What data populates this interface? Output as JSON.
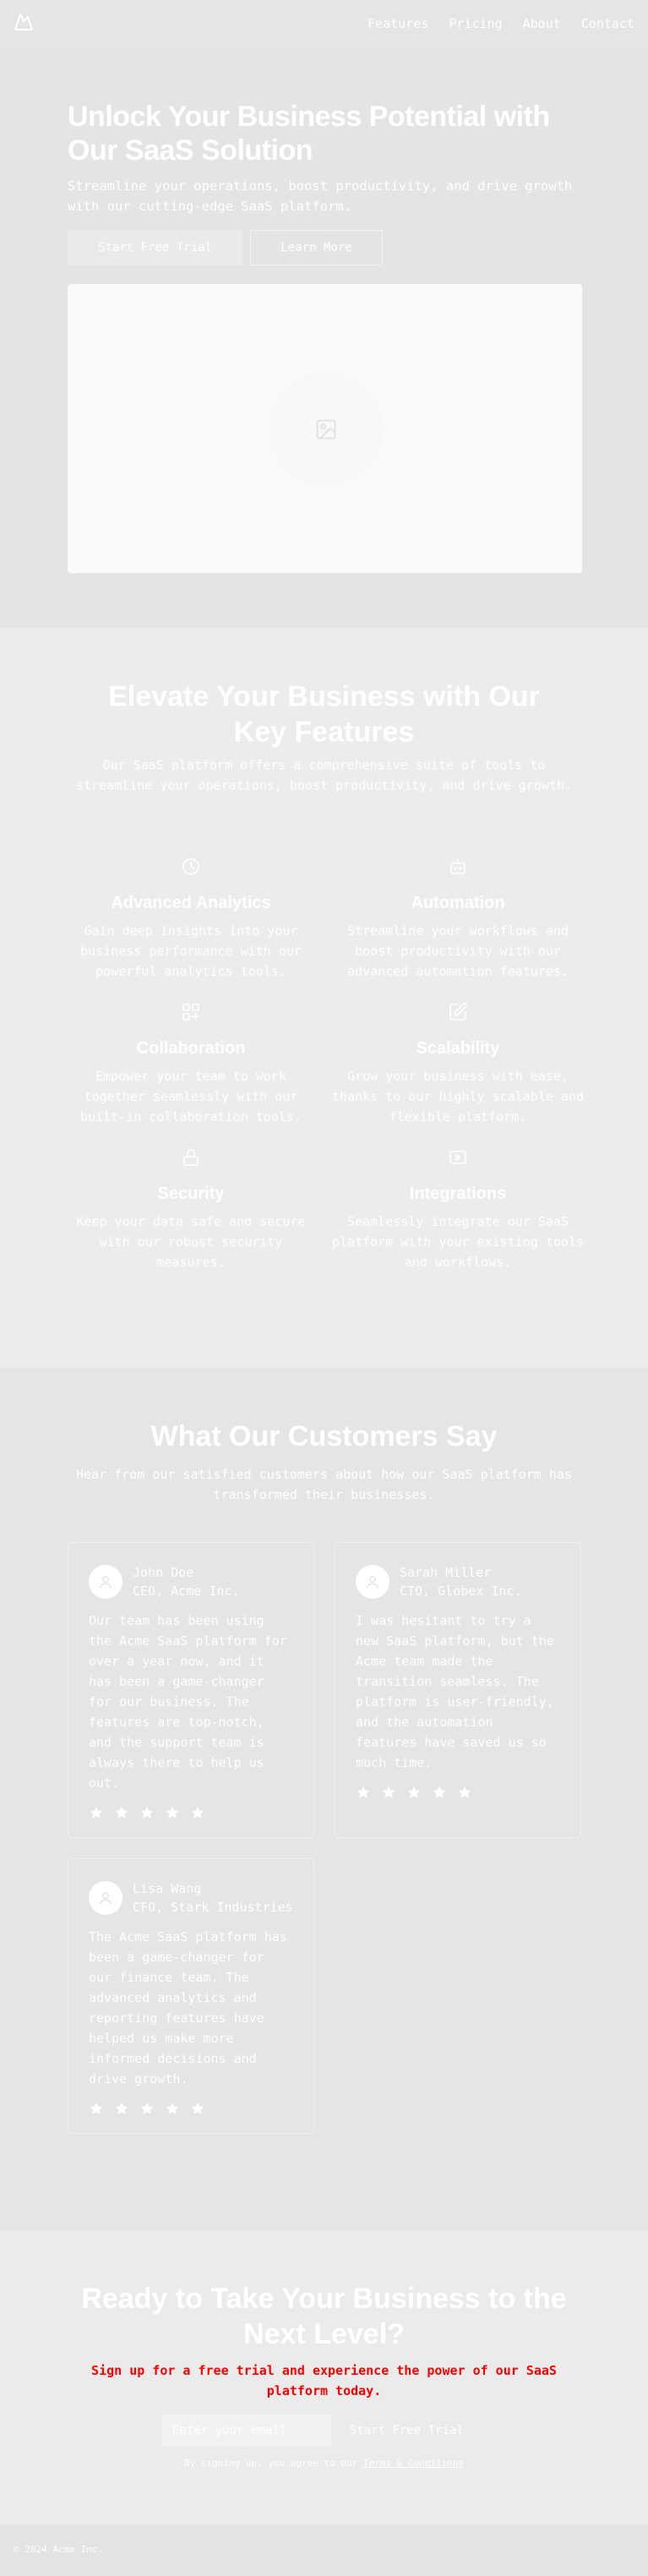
{
  "nav": {
    "logo_icon": "mountain-icon",
    "items": [
      "Features",
      "Pricing",
      "About",
      "Contact"
    ]
  },
  "hero": {
    "title": "Unlock Your Business Potential with Our SaaS Solution",
    "subtitle": "Streamline your operations, boost productivity, and drive growth with our cutting-edge SaaS platform.",
    "primary_button": "Start Free Trial",
    "secondary_button": "Learn More",
    "image_icon": "image-placeholder-icon"
  },
  "features": {
    "title": "Elevate Your Business with Our Key Features",
    "subtitle": "Our SaaS platform offers a comprehensive suite of tools to streamline your operations, boost productivity, and drive growth.",
    "items": [
      {
        "icon": "gauge-icon",
        "title": "Advanced Analytics",
        "description": "Gain deep insights into your business performance with our powerful analytics tools."
      },
      {
        "icon": "bot-icon",
        "title": "Automation",
        "description": "Streamline your workflows and boost productivity with our advanced automation features."
      },
      {
        "icon": "layout-grid-icon",
        "title": "Collaboration",
        "description": "Empower your team to work together seamlessly with our built-in collaboration tools."
      },
      {
        "icon": "edit-square-icon",
        "title": "Scalability",
        "description": "Grow your business with ease, thanks to our highly scalable and flexible platform."
      },
      {
        "icon": "lock-icon",
        "title": "Security",
        "description": "Keep your data safe and secure with our robust security measures."
      },
      {
        "icon": "integration-icon",
        "title": "Integrations",
        "description": "Seamlessly integrate our SaaS platform with your existing tools and workflows."
      }
    ]
  },
  "testimonials": {
    "title": "What Our Customers Say",
    "subtitle": "Hear from our satisfied customers about how our SaaS platform has transformed their businesses.",
    "items": [
      {
        "name": "John Doe",
        "role": "CEO, Acme Inc.",
        "quote": "Our team has been using the Acme SaaS platform for over a year now, and it has been a game-changer for our business. The features are top-notch, and the support team is always there to help us out.",
        "rating": 5
      },
      {
        "name": "Sarah Miller",
        "role": "CTO, Globex Inc.",
        "quote": "I was hesitant to try a new SaaS platform, but the Acme team made the transition seamless. The platform is user-friendly, and the automation features have saved us so much time.",
        "rating": 5
      },
      {
        "name": "Lisa Wang",
        "role": "CFO, Stark Industries",
        "quote": "The Acme SaaS platform has been a game-changer for our finance team. The advanced analytics and reporting features have helped us make more informed decisions and drive growth.",
        "rating": 5
      }
    ]
  },
  "cta": {
    "title": "Ready to Take Your Business to the Next Level?",
    "subtitle": "Sign up for a free trial and experience the power of our SaaS platform today.",
    "subtitle_color": "#ff0000",
    "email_placeholder": "Enter your email",
    "button": "Start Free Trial",
    "fine_print": "By signing up, you agree to our ",
    "terms_link": "Terms & Conditions"
  },
  "footer": {
    "copyright": "© 2024 Acme Inc."
  }
}
